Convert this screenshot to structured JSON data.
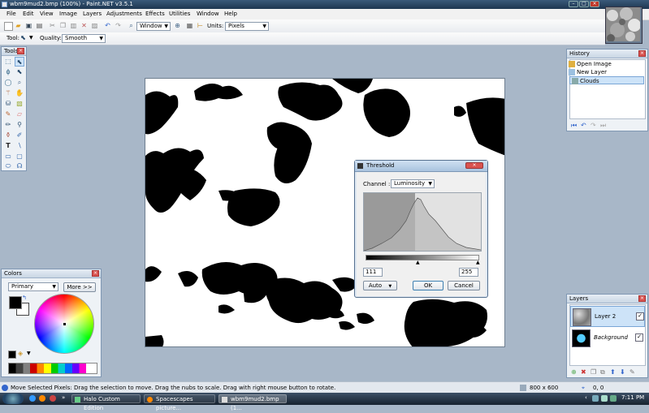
{
  "window": {
    "title": "wbm9mud2.bmp (100%) - Paint.NET v3.5.1"
  },
  "menu": [
    "File",
    "Edit",
    "View",
    "Image",
    "Layers",
    "Adjustments",
    "Effects",
    "Utilities",
    "Window",
    "Help"
  ],
  "toolbar": {
    "window_combo": "Window",
    "units_label": "Units:",
    "units_value": "Pixels",
    "tool_label": "Tool:",
    "quality_label": "Quality:",
    "quality_value": "Smooth"
  },
  "tools_panel": {
    "title": "Tools"
  },
  "history_panel": {
    "title": "History",
    "items": [
      "Open Image",
      "New Layer",
      "Clouds"
    ],
    "selected_index": 2
  },
  "threshold_dialog": {
    "title": "Threshold",
    "channel_label": "Channel :",
    "channel_value": "Luminosity",
    "low_value": "111",
    "high_value": "255",
    "auto_label": "Auto",
    "ok_label": "OK",
    "cancel_label": "Cancel"
  },
  "colors_panel": {
    "title": "Colors",
    "mode": "Primary",
    "more_label": "More >>",
    "primary_color": "#000000",
    "secondary_color": "#ffffff"
  },
  "layers_panel": {
    "title": "Layers",
    "items": [
      {
        "name": "Layer 2",
        "checked": true,
        "selected": true
      },
      {
        "name": "Background",
        "checked": true,
        "selected": false
      }
    ]
  },
  "status": {
    "message": "Move Selected Pixels: Drag the selection to move. Drag the nubs to scale. Drag with right mouse button to rotate.",
    "size": "800 x 600",
    "position": "0, 0"
  },
  "taskbar": {
    "tasks": [
      "Halo Custom Edition",
      "Spacescapes picture...",
      "wbm9mud2.bmp (1..."
    ],
    "clock": "7:11 PM"
  },
  "colors": {
    "accent": "#3399ff",
    "selection": "#cde3f8",
    "threshold_bg": "#5b5b5b"
  }
}
